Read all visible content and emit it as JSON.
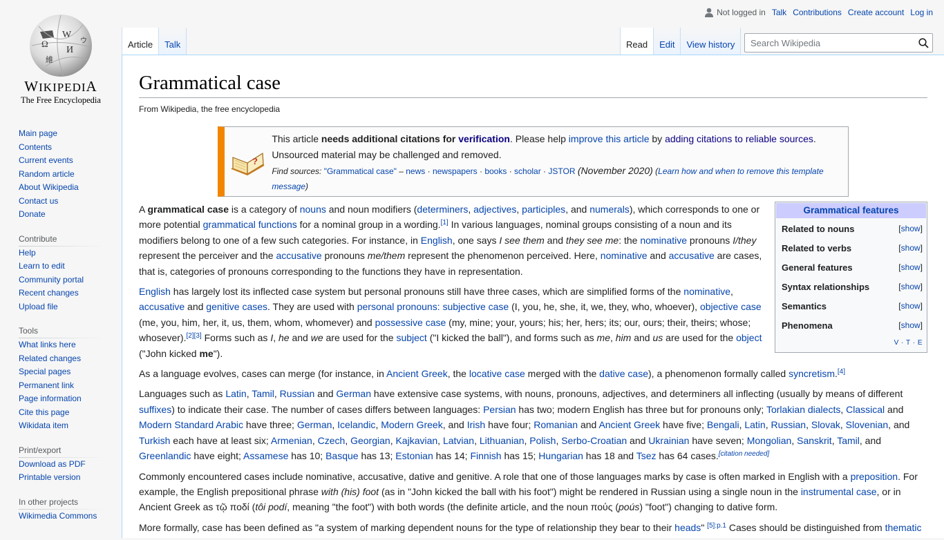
{
  "logo": {
    "wordmark_first": "W",
    "wordmark_rest": "IKIPEDI",
    "wordmark_last": "A",
    "tagline": "The Free Encyclopedia"
  },
  "sidebar": {
    "navigation": [
      "Main page",
      "Contents",
      "Current events",
      "Random article",
      "About Wikipedia",
      "Contact us",
      "Donate"
    ],
    "contribute": {
      "heading": "Contribute",
      "items": [
        "Help",
        "Learn to edit",
        "Community portal",
        "Recent changes",
        "Upload file"
      ]
    },
    "tools": {
      "heading": "Tools",
      "items": [
        "What links here",
        "Related changes",
        "Special pages",
        "Permanent link",
        "Page information",
        "Cite this page",
        "Wikidata item"
      ]
    },
    "print": {
      "heading": "Print/export",
      "items": [
        "Download as PDF",
        "Printable version"
      ]
    },
    "projects": {
      "heading": "In other projects",
      "items": [
        "Wikimedia Commons"
      ]
    }
  },
  "personal": {
    "status": "Not logged in",
    "links": [
      "Talk",
      "Contributions",
      "Create account",
      "Log in"
    ]
  },
  "tabs": {
    "left": [
      {
        "label": "Article",
        "selected": true
      },
      {
        "label": "Talk",
        "selected": false
      }
    ],
    "right": [
      {
        "label": "Read",
        "selected": true
      },
      {
        "label": "Edit",
        "selected": false
      },
      {
        "label": "View history",
        "selected": false
      }
    ]
  },
  "search": {
    "placeholder": "Search Wikipedia",
    "value": ""
  },
  "article": {
    "title": "Grammatical case",
    "subtitle": "From Wikipedia, the free encyclopedia"
  },
  "ambox": {
    "l1_a": "This article ",
    "l1_b": "needs additional citations for ",
    "l1_c": "verification",
    "l1_d": ". Please help ",
    "l1_e": "improve this article",
    "l1_f": " by ",
    "l1_g": "adding citations to reliable sources",
    "l1_h": ".",
    "l2": "Unsourced material may be challenged and removed.",
    "find_label": "Find sources:",
    "find_query": "\"Grammatical case\"",
    "find_sep": " – ",
    "sources": [
      "news",
      "newspapers",
      "books",
      "scholar",
      "JSTOR"
    ],
    "date": "(November 2020)",
    "learn": "Learn how and when to remove this template message"
  },
  "navbox": {
    "title": "Grammatical features",
    "rows": [
      "Related to nouns",
      "Related to verbs",
      "General features",
      "Syntax relationships",
      "Semantics",
      "Phenomena"
    ],
    "show_label": "show",
    "vte": [
      "V",
      "T",
      "E"
    ]
  },
  "paragraphs": {
    "p1": [
      {
        "t": "A "
      },
      {
        "t": "grammatical case",
        "b": 1
      },
      {
        "t": " is a category of "
      },
      {
        "t": "nouns",
        "l": 1
      },
      {
        "t": " and noun modifiers ("
      },
      {
        "t": "determiners",
        "l": 1
      },
      {
        "t": ", "
      },
      {
        "t": "adjectives",
        "l": 1
      },
      {
        "t": ", "
      },
      {
        "t": "participles",
        "l": 1
      },
      {
        "t": ", and "
      },
      {
        "t": "numerals",
        "l": 1
      },
      {
        "t": "), which corresponds to one or more potential "
      },
      {
        "t": "grammatical functions",
        "l": 1
      },
      {
        "t": " for a nominal group in a wording."
      },
      {
        "t": "[1]",
        "s": 1
      },
      {
        "t": " In various languages, nominal groups consisting of a noun and its modifiers belong to one of a few such categories. For instance, in "
      },
      {
        "t": "English",
        "l": 1
      },
      {
        "t": ", one says "
      },
      {
        "t": "I see them",
        "i": 1
      },
      {
        "t": " and "
      },
      {
        "t": "they see me",
        "i": 1
      },
      {
        "t": ": the "
      },
      {
        "t": "nominative",
        "l": 1
      },
      {
        "t": " pronouns "
      },
      {
        "t": "I/they",
        "i": 1
      },
      {
        "t": " represent the perceiver and the "
      },
      {
        "t": "accusative",
        "l": 1
      },
      {
        "t": " pronouns "
      },
      {
        "t": "me/them",
        "i": 1
      },
      {
        "t": " represent the phenomenon perceived. Here, "
      },
      {
        "t": "nominative",
        "l": 1
      },
      {
        "t": " and "
      },
      {
        "t": "accusative",
        "l": 1
      },
      {
        "t": " are cases, that is, categories of pronouns corresponding to the functions they have in representation."
      }
    ],
    "p2": [
      {
        "t": "English",
        "l": 1
      },
      {
        "t": " has largely lost its inflected case system but personal pronouns still have three cases, which are simplified forms of the "
      },
      {
        "t": "nominative",
        "l": 1
      },
      {
        "t": ", "
      },
      {
        "t": "accusative",
        "l": 1
      },
      {
        "t": " and "
      },
      {
        "t": "genitive cases",
        "l": 1
      },
      {
        "t": ". They are used with "
      },
      {
        "t": "personal pronouns: subjective case",
        "l": 1
      },
      {
        "t": " (I, you, he, she, it, we, they, who, whoever), "
      },
      {
        "t": "objective case",
        "l": 1
      },
      {
        "t": " (me, you, him, her, it, us, them, whom, whomever) and "
      },
      {
        "t": "possessive case",
        "l": 1
      },
      {
        "t": " (my, mine; your, yours; his; her, hers; its; our, ours; their, theirs; whose; whosever)."
      },
      {
        "t": "[2]",
        "s": 1
      },
      {
        "t": "[3]",
        "s": 1
      },
      {
        "t": " Forms such as "
      },
      {
        "t": "I",
        "i": 1
      },
      {
        "t": ", "
      },
      {
        "t": "he",
        "i": 1
      },
      {
        "t": " and "
      },
      {
        "t": "we",
        "i": 1
      },
      {
        "t": " are used for the "
      },
      {
        "t": "subject",
        "l": 1
      },
      {
        "t": " (\"I kicked the ball\"), and forms such as "
      },
      {
        "t": "me",
        "i": 1
      },
      {
        "t": ", "
      },
      {
        "t": "him",
        "i": 1
      },
      {
        "t": " and "
      },
      {
        "t": "us",
        "i": 1
      },
      {
        "t": " are used for the "
      },
      {
        "t": "object",
        "l": 1
      },
      {
        "t": " (\"John kicked "
      },
      {
        "t": "me",
        "b": 1
      },
      {
        "t": "\")."
      }
    ],
    "p3": [
      {
        "t": "As a language evolves, cases can merge (for instance, in "
      },
      {
        "t": "Ancient Greek",
        "l": 1
      },
      {
        "t": ", the "
      },
      {
        "t": "locative case",
        "l": 1
      },
      {
        "t": " merged with the "
      },
      {
        "t": "dative case",
        "l": 1
      },
      {
        "t": "), a phenomenon formally called "
      },
      {
        "t": "syncretism",
        "l": 1
      },
      {
        "t": "."
      },
      {
        "t": "[4]",
        "s": 1
      }
    ],
    "p4": [
      {
        "t": "Languages such as "
      },
      {
        "t": "Latin",
        "l": 1
      },
      {
        "t": ", "
      },
      {
        "t": "Tamil",
        "l": 1
      },
      {
        "t": ", "
      },
      {
        "t": "Russian",
        "l": 1
      },
      {
        "t": " and "
      },
      {
        "t": "German",
        "l": 1
      },
      {
        "t": " have extensive case systems, with nouns, pronouns, adjectives, and determiners all inflecting (usually by means of different "
      },
      {
        "t": "suffixes",
        "l": 1
      },
      {
        "t": ") to indicate their case. The number of cases differs between languages: "
      },
      {
        "t": "Persian",
        "l": 1
      },
      {
        "t": " has two; modern English has three but for pronouns only; "
      },
      {
        "t": "Torlakian dialects",
        "l": 1
      },
      {
        "t": ", "
      },
      {
        "t": "Classical",
        "l": 1
      },
      {
        "t": " and "
      },
      {
        "t": "Modern Standard Arabic",
        "l": 1
      },
      {
        "t": " have three; "
      },
      {
        "t": "German",
        "l": 1
      },
      {
        "t": ", "
      },
      {
        "t": "Icelandic",
        "l": 1
      },
      {
        "t": ", "
      },
      {
        "t": "Modern Greek",
        "l": 1
      },
      {
        "t": ", and "
      },
      {
        "t": "Irish",
        "l": 1
      },
      {
        "t": " have four; "
      },
      {
        "t": "Romanian",
        "l": 1
      },
      {
        "t": " and "
      },
      {
        "t": "Ancient Greek",
        "l": 1
      },
      {
        "t": " have five; "
      },
      {
        "t": "Bengali",
        "l": 1
      },
      {
        "t": ", "
      },
      {
        "t": "Latin",
        "l": 1
      },
      {
        "t": ", "
      },
      {
        "t": "Russian",
        "l": 1
      },
      {
        "t": ", "
      },
      {
        "t": "Slovak",
        "l": 1
      },
      {
        "t": ", "
      },
      {
        "t": "Slovenian",
        "l": 1
      },
      {
        "t": ", and "
      },
      {
        "t": "Turkish",
        "l": 1
      },
      {
        "t": " each have at least six; "
      },
      {
        "t": "Armenian",
        "l": 1
      },
      {
        "t": ", "
      },
      {
        "t": "Czech",
        "l": 1
      },
      {
        "t": ", "
      },
      {
        "t": "Georgian",
        "l": 1
      },
      {
        "t": ", "
      },
      {
        "t": "Kajkavian",
        "l": 1
      },
      {
        "t": ", "
      },
      {
        "t": "Latvian",
        "l": 1
      },
      {
        "t": ", "
      },
      {
        "t": "Lithuanian",
        "l": 1
      },
      {
        "t": ", "
      },
      {
        "t": "Polish",
        "l": 1
      },
      {
        "t": ", "
      },
      {
        "t": "Serbo-Croatian",
        "l": 1
      },
      {
        "t": " and "
      },
      {
        "t": "Ukrainian",
        "l": 1
      },
      {
        "t": " have seven; "
      },
      {
        "t": "Mongolian",
        "l": 1
      },
      {
        "t": ", "
      },
      {
        "t": "Sanskrit",
        "l": 1
      },
      {
        "t": ", "
      },
      {
        "t": "Tamil",
        "l": 1
      },
      {
        "t": ", and "
      },
      {
        "t": "Greenlandic",
        "l": 1
      },
      {
        "t": " have eight; "
      },
      {
        "t": "Assamese",
        "l": 1
      },
      {
        "t": " has 10; "
      },
      {
        "t": "Basque",
        "l": 1
      },
      {
        "t": " has 13; "
      },
      {
        "t": "Estonian",
        "l": 1
      },
      {
        "t": " has 14; "
      },
      {
        "t": "Finnish",
        "l": 1
      },
      {
        "t": " has 15; "
      },
      {
        "t": "Hungarian",
        "l": 1
      },
      {
        "t": " has 18 and "
      },
      {
        "t": "Tsez",
        "l": 1
      },
      {
        "t": " has 64 cases."
      },
      {
        "t": "[citation needed]",
        "s": 1,
        "i": 1
      }
    ],
    "p5": [
      {
        "t": "Commonly encountered cases include nominative, accusative, dative and genitive. A role that one of those languages marks by case is often marked in English with a "
      },
      {
        "t": "preposition",
        "l": 1
      },
      {
        "t": ". For example, the English prepositional phrase "
      },
      {
        "t": "with (his) foot",
        "i": 1
      },
      {
        "t": " (as in \"John kicked the ball with his foot\") might be rendered in Russian using a single noun in the "
      },
      {
        "t": "instrumental case",
        "l": 1
      },
      {
        "t": ", or in Ancient Greek as τῷ ποδί ("
      },
      {
        "t": "tôi podí",
        "i": 1
      },
      {
        "t": ", meaning \"the foot\") with both words (the definite article, and the noun πούς ("
      },
      {
        "t": "poús",
        "i": 1
      },
      {
        "t": ") \"foot\") changing to dative form."
      }
    ],
    "p6": [
      {
        "t": "More formally, case has been defined as \"a system of marking dependent nouns for the type of relationship they bear to their "
      },
      {
        "t": "heads",
        "l": 1
      },
      {
        "t": "\" "
      },
      {
        "t": "[5]:p.1",
        "s": 1
      },
      {
        "t": " Cases should be distinguished from "
      },
      {
        "t": "thematic",
        "l": 1
      }
    ]
  }
}
